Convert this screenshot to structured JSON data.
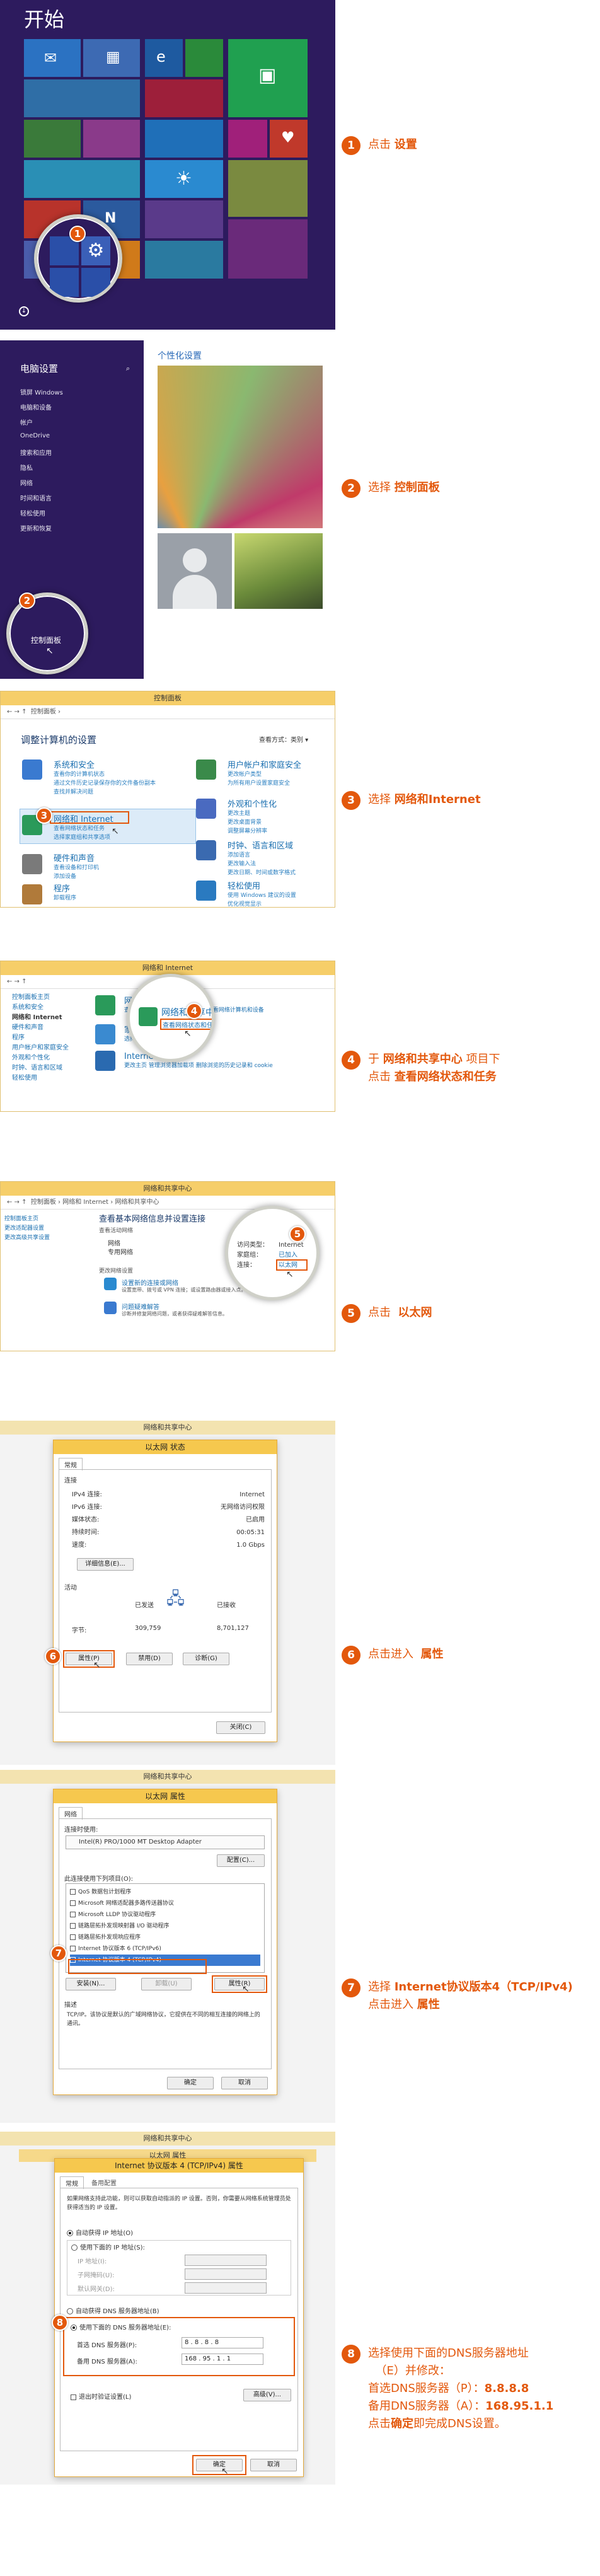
{
  "steps": [
    {
      "num": "1",
      "text": "点击",
      "bold": "设置",
      "after": ""
    },
    {
      "num": "2",
      "text": "选择",
      "bold": "控制面板",
      "after": ""
    },
    {
      "num": "3",
      "text": "选择",
      "bold": "网络和Internet",
      "after": ""
    },
    {
      "num": "4",
      "text": "于",
      "bold": "网络和共享中心",
      "after": "项目下",
      "line2_pre": "点击",
      "line2_bold": "查看网络状态和任务"
    },
    {
      "num": "5",
      "text": "点击",
      "bold": "以太网",
      "after": ""
    },
    {
      "num": "6",
      "text": "点击进入",
      "bold": "属性",
      "after": ""
    },
    {
      "num": "7",
      "text": "选择",
      "bold": "Internet协议版本4（TCP/IPv4)",
      "after": "",
      "line2_pre": "点击进入",
      "line2_bold": "属性"
    },
    {
      "num": "8",
      "text": "选择使用下面的DNS服务器地址",
      "line2": "（E）并修改：",
      "line3_pre": "首选DNS服务器（P）：",
      "line3_bold": "8.8.8.8",
      "line4_pre": "备用DNS服务器（A）：",
      "line4_bold": "168.95.1.1",
      "line5_pre": "点击",
      "line5_bold": "确定",
      "line5_post": "即完成DNS设置。"
    }
  ],
  "start": {
    "title": "开始"
  },
  "pcsettings": {
    "heading": "电脑设置",
    "items": [
      "锁屏 Windows",
      "电脑和设备",
      "帐户",
      "OneDrive",
      "搜索和应用",
      "隐私",
      "网络",
      "时间和语言",
      "轻松使用",
      "更新和恢复"
    ],
    "control_panel": "控制面板",
    "personalize": "个性化设置"
  },
  "cp": {
    "title": "控制面板",
    "address": "控制面板 ›",
    "heading": "调整计算机的设置",
    "viewby": "查看方式：类别 ▾",
    "items": [
      {
        "t": "系统和安全",
        "s": [
          "查看你的计算机状态",
          "通过文件历史记录保存你的文件备份副本",
          "查找并解决问题"
        ]
      },
      {
        "t": "网络和 Internet",
        "s": [
          "查看网络状态和任务",
          "选择家庭组和共享选项"
        ]
      },
      {
        "t": "硬件和声音",
        "s": [
          "查看设备和打印机",
          "添加设备"
        ]
      },
      {
        "t": "程序",
        "s": [
          "卸载程序"
        ]
      },
      {
        "t": "用户帐户和家庭安全",
        "s": [
          "更改帐户类型",
          "为所有用户设置家庭安全"
        ]
      },
      {
        "t": "外观和个性化",
        "s": [
          "更改主题",
          "更改桌面背景",
          "调整屏幕分辨率"
        ]
      },
      {
        "t": "时钟、语言和区域",
        "s": [
          "添加语言",
          "更改输入法",
          "更改日期、时间或数字格式"
        ]
      },
      {
        "t": "轻松使用",
        "s": [
          "使用 Windows 建议的设置",
          "优化视觉显示"
        ]
      }
    ]
  },
  "net": {
    "title": "网络和 Internet",
    "home": "控制面板主页",
    "left": [
      "系统和安全",
      "网络和 Internet",
      "硬件和声音",
      "程序",
      "用户帐户和家庭安全",
      "外观和个性化",
      "时钟、语言和区域",
      "轻松使用"
    ],
    "nsc": "网络和共享中心",
    "nsc_links": "查看网络状态和任务   连接到网络   查看网络计算机和设备",
    "hg": "家庭组",
    "hg_link": "选择家庭组和共享选项",
    "io": "Internet 选项",
    "io_links": "更改主页   管理浏览器加载项   删除浏览的历史记录和 cookie"
  },
  "share": {
    "title": "网络和共享中心",
    "crumb": "控制面板 › 网络和 Internet › 网络和共享中心",
    "heading": "查看基本网络信息并设置连接",
    "active": "查看活动网络",
    "network": "网络",
    "private": "专用网络",
    "access": "访问类型：",
    "access_val": "Internet",
    "hg": "家庭组：",
    "hg_val": "已加入",
    "conn": "连接：",
    "conn_val": "以太网",
    "change": "更改网络设置",
    "set1": "设置新的连接或网络",
    "set1d": "设置宽带、拨号或 VPN 连接；或设置路由器或接入点。",
    "set2": "问题疑难解答",
    "set2d": "诊断并修复网络问题，或者获得疑难解答信息。",
    "left": [
      "控制面板主页",
      "更改适配器设置",
      "更改高级共享设置"
    ]
  },
  "eth": {
    "title": "以太网 状态",
    "tab": "常规",
    "conn": "连接",
    "rows": [
      [
        "IPv4 连接:",
        "Internet"
      ],
      [
        "IPv6 连接:",
        "无网络访问权限"
      ],
      [
        "媒体状态:",
        "已启用"
      ],
      [
        "持续时间:",
        "00:05:31"
      ],
      [
        "速度:",
        "1.0 Gbps"
      ]
    ],
    "details": "详细信息(E)...",
    "activity": "活动",
    "sent": "已发送",
    "recv": "已接收",
    "bytes": "字节:",
    "sent_val": "309,759",
    "recv_val": "8,701,127",
    "props": "属性(P)",
    "disable": "禁用(D)",
    "diag": "诊断(G)",
    "close": "关闭(C)"
  },
  "ethp": {
    "title": "以太网 属性",
    "tab": "网络",
    "connect": "连接时使用:",
    "adapter": "Intel(R) PRO/1000 MT Desktop Adapter",
    "config": "配置(C)...",
    "uses": "此连接使用下列项目(O):",
    "items": [
      "QoS 数据包计划程序",
      "Microsoft 网络适配器多路传送器协议",
      "Microsoft LLDP 协议驱动程序",
      "链路层拓扑发现映射器 I/O 驱动程序",
      "链路层拓扑发现响应程序",
      "Internet 协议版本 6 (TCP/IPv6)",
      "Internet 协议版本 4 (TCP/IPv4)"
    ],
    "install": "安装(N)...",
    "uninstall": "卸载(U)",
    "props": "属性(R)",
    "desc": "描述",
    "desc_text": "TCP/IP。该协议是默认的广域网络协议，它提供在不同的相互连接的网络上的通讯。",
    "ok": "确定",
    "cancel": "取消"
  },
  "ipv4": {
    "title": "Internet 协议版本 4 (TCP/IPv4) 属性",
    "tab1": "常规",
    "tab2": "备用配置",
    "intro": "如果网络支持此功能，则可以获取自动指派的 IP 设置。否则，你需要从网络系统管理员处获得适当的 IP 设置。",
    "auto_ip": "自动获得 IP 地址(O)",
    "use_ip": "使用下面的 IP 地址(S):",
    "ip": "IP 地址(I):",
    "mask": "子网掩码(U):",
    "gw": "默认网关(D):",
    "auto_dns": "自动获得 DNS 服务器地址(B)",
    "use_dns": "使用下面的 DNS 服务器地址(E):",
    "pdns": "首选 DNS 服务器(P):",
    "pdns_val": "8 . 8 . 8 . 8",
    "adns": "备用 DNS 服务器(A):",
    "adns_val": "168 . 95 . 1 . 1",
    "validate": "退出时验证设置(L)",
    "adv": "高级(V)...",
    "ok": "确定",
    "cancel": "取消"
  },
  "colors": {
    "accent": "#e3580c",
    "start_bg": "#2d1b5e",
    "titlebar": "#f6ce69"
  }
}
